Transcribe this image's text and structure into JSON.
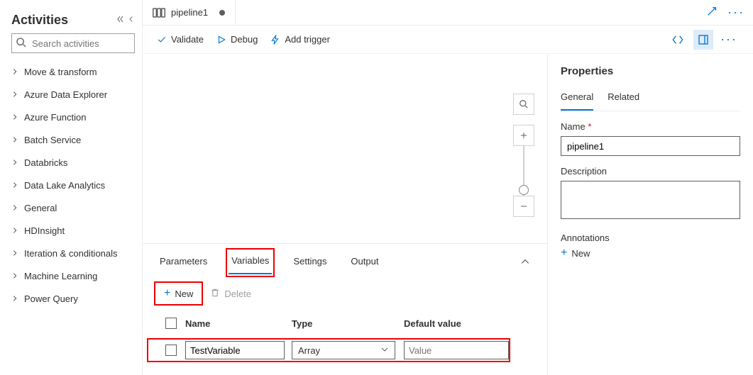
{
  "sidebar": {
    "title": "Activities",
    "search_placeholder": "Search activities",
    "items": [
      "Move & transform",
      "Azure Data Explorer",
      "Azure Function",
      "Batch Service",
      "Databricks",
      "Data Lake Analytics",
      "General",
      "HDInsight",
      "Iteration & conditionals",
      "Machine Learning",
      "Power Query"
    ]
  },
  "editor_tab": {
    "title": "pipeline1",
    "dirty": true
  },
  "toolbar": {
    "validate": "Validate",
    "debug": "Debug",
    "add_trigger": "Add trigger"
  },
  "props": {
    "heading": "Properties",
    "tabs": {
      "general": "General",
      "related": "Related"
    },
    "name_label": "Name",
    "name_value": "pipeline1",
    "desc_label": "Description",
    "desc_value": "",
    "annot_label": "Annotations",
    "new_label": "New"
  },
  "bottom": {
    "tabs": {
      "parameters": "Parameters",
      "variables": "Variables",
      "settings": "Settings",
      "output": "Output"
    },
    "new_label": "New",
    "delete_label": "Delete",
    "columns": {
      "name": "Name",
      "type": "Type",
      "default": "Default value"
    },
    "rows": [
      {
        "name": "TestVariable",
        "type": "Array",
        "default_placeholder": "Value"
      }
    ]
  }
}
